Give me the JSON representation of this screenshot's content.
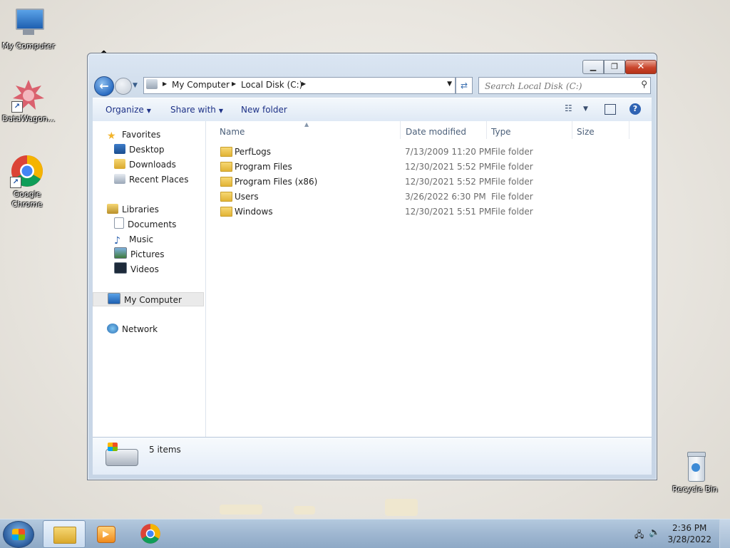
{
  "desktop": {
    "icons": [
      {
        "label": "My Computer"
      },
      {
        "label": "DataWagon..."
      },
      {
        "label": "Google Chrome"
      },
      {
        "label": "Recycle Bin"
      }
    ]
  },
  "window": {
    "controls": {
      "minimize": "▁",
      "maximize": "❐",
      "close": "✕"
    },
    "address": {
      "path": [
        "My Computer",
        "Local Disk (C:)"
      ]
    },
    "search": {
      "placeholder": "Search Local Disk (C:)"
    },
    "toolbar": {
      "organize": "Organize",
      "share_with": "Share with",
      "new_folder": "New folder"
    },
    "nav": {
      "favorites": {
        "label": "Favorites",
        "items": [
          "Desktop",
          "Downloads",
          "Recent Places"
        ]
      },
      "libraries": {
        "label": "Libraries",
        "items": [
          "Documents",
          "Music",
          "Pictures",
          "Videos"
        ]
      },
      "computer": "My Computer",
      "network": "Network"
    },
    "columns": {
      "name": "Name",
      "date_modified": "Date modified",
      "type": "Type",
      "size": "Size"
    },
    "rows": [
      {
        "name": "PerfLogs",
        "date": "7/13/2009 11:20 PM",
        "type": "File folder"
      },
      {
        "name": "Program Files",
        "date": "12/30/2021 5:52 PM",
        "type": "File folder"
      },
      {
        "name": "Program Files (x86)",
        "date": "12/30/2021 5:52 PM",
        "type": "File folder"
      },
      {
        "name": "Users",
        "date": "3/26/2022 6:30 PM",
        "type": "File folder"
      },
      {
        "name": "Windows",
        "date": "12/30/2021 5:51 PM",
        "type": "File folder"
      }
    ],
    "details": {
      "item_count": "5 items"
    }
  },
  "taskbar": {
    "clock": {
      "time": "2:36 PM",
      "date": "3/28/2022"
    }
  },
  "colors": {
    "accent": "#2a6cc2",
    "link": "#1e3287",
    "folder": "#e2b436"
  }
}
